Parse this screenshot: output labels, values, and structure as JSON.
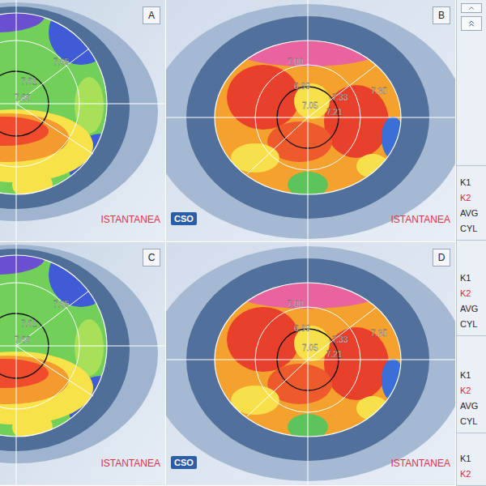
{
  "panels": [
    {
      "label": "A",
      "kind": "left",
      "map_values": [
        "7.65",
        "7.61",
        "7.66"
      ],
      "mode": "ISTANTANEA"
    },
    {
      "label": "B",
      "kind": "right",
      "map_values": [
        "7.00",
        "6.99",
        "7.05",
        "7.33",
        "7.35",
        "7.21"
      ],
      "mode": "ISTANTANEA",
      "logo": "CSO"
    },
    {
      "label": "C",
      "kind": "left",
      "map_values": [
        "7.65",
        "7.61",
        "7.66"
      ],
      "mode": "ISTANTANEA"
    },
    {
      "label": "D",
      "kind": "right",
      "map_values": [
        "7.00",
        "6.99",
        "7.05",
        "7.33",
        "7.35",
        "7.21"
      ],
      "mode": "ISTANTANEA",
      "logo": "CSO"
    }
  ],
  "sidebar": {
    "groups": [
      {
        "items": [
          {
            "text": "K1",
            "color": "#1f2937"
          },
          {
            "text": "K2",
            "color": "#d9283a"
          },
          {
            "text": "AVG",
            "color": "#1f2937"
          },
          {
            "text": "CYL",
            "color": "#1f2937"
          }
        ]
      },
      {
        "items": [
          {
            "text": "K1",
            "color": "#1f2937"
          },
          {
            "text": "K2",
            "color": "#d9283a"
          },
          {
            "text": "AVG",
            "color": "#1f2937"
          },
          {
            "text": "CYL",
            "color": "#1f2937"
          }
        ]
      },
      {
        "items": [
          {
            "text": "K1",
            "color": "#1f2937"
          },
          {
            "text": "K2",
            "color": "#d9283a"
          },
          {
            "text": "AVG",
            "color": "#1f2937"
          },
          {
            "text": "CYL",
            "color": "#1f2937"
          }
        ]
      },
      {
        "items": [
          {
            "text": "K1",
            "color": "#1f2937"
          },
          {
            "text": "K2",
            "color": "#d9283a"
          }
        ]
      }
    ]
  }
}
